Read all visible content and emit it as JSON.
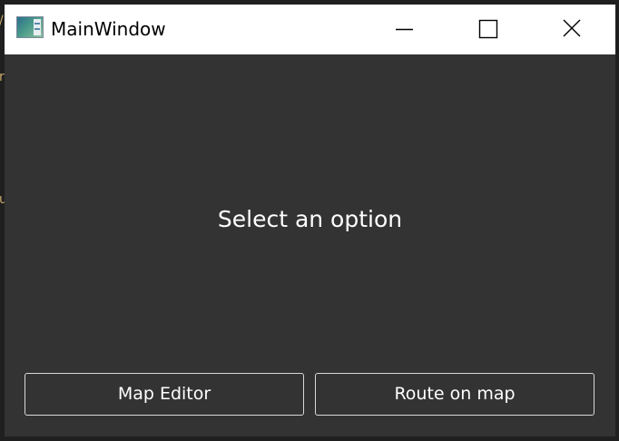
{
  "window": {
    "title": "MainWindow",
    "icon": "app-window-icon"
  },
  "titlebar_controls": {
    "minimize_icon": "minimize-icon",
    "maximize_icon": "maximize-icon",
    "close_icon": "close-icon"
  },
  "main": {
    "prompt": "Select an option"
  },
  "buttons": {
    "map_editor": "Map Editor",
    "route_on_map": "Route on map"
  }
}
